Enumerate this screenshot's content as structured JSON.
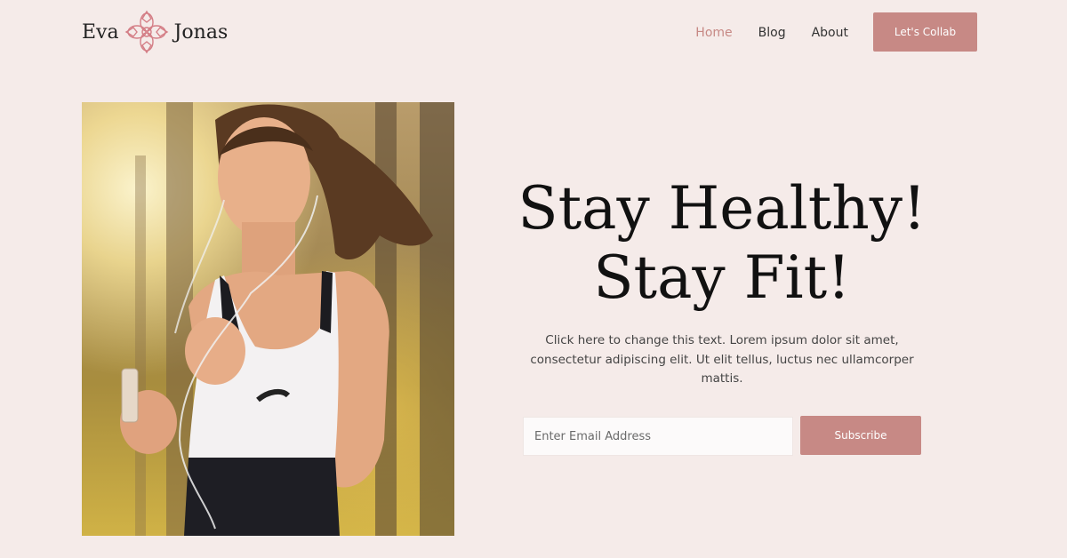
{
  "header": {
    "logo": {
      "left": "Eva",
      "right": "Jonas",
      "mark_icon": "flower-ornament-icon",
      "mark_color": "#d47e86"
    },
    "nav": [
      {
        "label": "Home",
        "active": true
      },
      {
        "label": "Blog",
        "active": false
      },
      {
        "label": "About",
        "active": false
      }
    ],
    "cta_label": "Let's Collab"
  },
  "hero": {
    "image_subject": "woman-jogging-photo",
    "headline_line1": "Stay Healthy!",
    "headline_line2": "Stay Fit!",
    "body": "Click here to change this text. Lorem ipsum dolor sit amet, consectetur adipiscing elit. Ut elit tellus, luctus nec ullamcorper mattis.",
    "email_placeholder": "Enter Email Address",
    "subscribe_label": "Subscribe"
  },
  "colors": {
    "background": "#f5ebe9",
    "accent": "#c78985",
    "text": "#111111"
  }
}
